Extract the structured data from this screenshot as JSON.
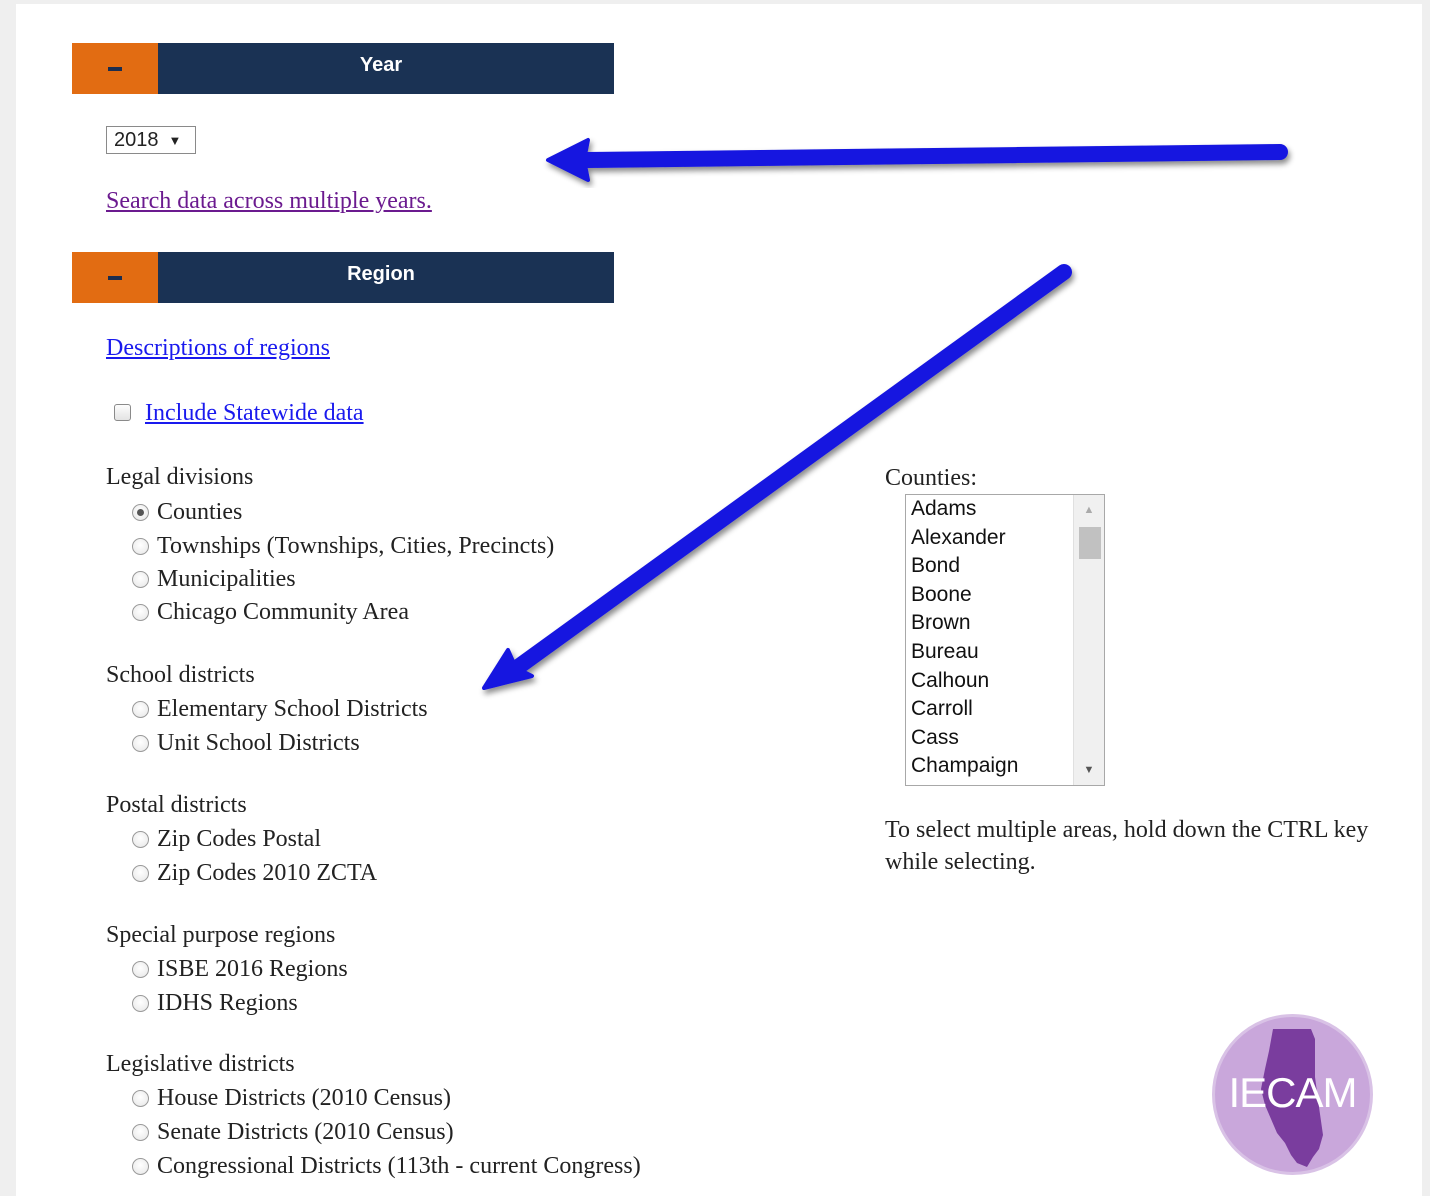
{
  "year_panel": {
    "title": "Year",
    "selected_year": "2018",
    "caret": "▼",
    "multi_year_link": "Search data across multiple years."
  },
  "region_panel": {
    "title": "Region",
    "descriptions_link": "Descriptions of regions",
    "statewide_label": "Include Statewide data",
    "statewide_checked": false,
    "groups": [
      {
        "label": "Legal divisions",
        "options": [
          "Counties",
          "Townships (Townships, Cities, Precincts)",
          "Municipalities",
          "Chicago Community Area"
        ]
      },
      {
        "label": "School districts",
        "options": [
          "Elementary School Districts",
          "Unit School Districts"
        ]
      },
      {
        "label": "Postal districts",
        "options": [
          "Zip Codes Postal",
          "Zip Codes 2010 ZCTA"
        ]
      },
      {
        "label": "Special purpose regions",
        "options": [
          "ISBE 2016 Regions",
          "IDHS Regions"
        ]
      },
      {
        "label": "Legislative districts",
        "options": [
          "House Districts (2010 Census)",
          "Senate Districts (2010 Census)",
          "Congressional Districts (113th - current Congress)"
        ]
      }
    ],
    "selected_option": "Counties"
  },
  "counties": {
    "label": "Counties:",
    "items": [
      "Adams",
      "Alexander",
      "Bond",
      "Boone",
      "Brown",
      "Bureau",
      "Calhoun",
      "Carroll",
      "Cass",
      "Champaign"
    ],
    "hint": "To select multiple areas, hold down the CTRL key while selecting."
  },
  "logo": {
    "text": "IECAM"
  },
  "colors": {
    "header_navy": "#1a3254",
    "toggle_orange": "#e26c12",
    "arrow_blue": "#1515e0",
    "logo_purple": "#c9a7db",
    "state_purple": "#7a3d9e"
  },
  "icons": {
    "toggle": "minus-icon",
    "annotation": "arrow-icon"
  }
}
